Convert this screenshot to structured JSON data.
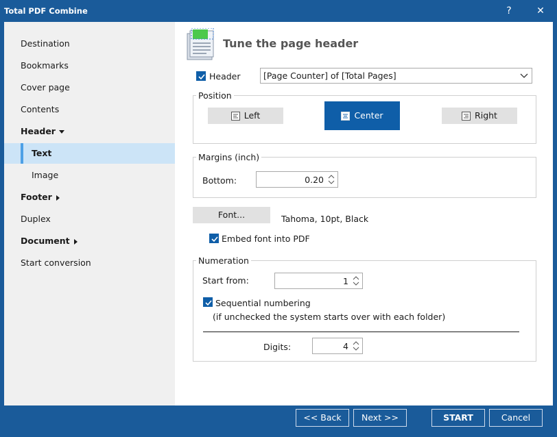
{
  "window": {
    "title": "Total PDF Combine",
    "help_label": "?",
    "close_label": "✕"
  },
  "sidebar": {
    "items": [
      {
        "label": "Destination"
      },
      {
        "label": "Bookmarks"
      },
      {
        "label": "Cover page"
      },
      {
        "label": "Contents"
      },
      {
        "label": "Header"
      },
      {
        "label": "Text"
      },
      {
        "label": "Image"
      },
      {
        "label": "Footer"
      },
      {
        "label": "Duplex"
      },
      {
        "label": "Document"
      },
      {
        "label": "Start conversion"
      }
    ]
  },
  "main": {
    "title": "Tune the page header",
    "header_checkbox": {
      "label": "Header",
      "checked": true
    },
    "header_select": {
      "value": "[Page Counter] of [Total Pages]"
    },
    "position": {
      "title": "Position",
      "buttons": [
        {
          "label": "Left"
        },
        {
          "label": "Center",
          "active": true
        },
        {
          "label": "Right"
        }
      ]
    },
    "margins": {
      "title": "Margins (inch)",
      "bottom_label": "Bottom:",
      "bottom_value": "0.20"
    },
    "font": {
      "button_label": "Font...",
      "description": "Tahoma, 10pt, Black",
      "embed_label": "Embed font into PDF",
      "embed_checked": true
    },
    "numeration": {
      "title": "Numeration",
      "start_label": "Start from:",
      "start_value": "1",
      "sequential_label": "Sequential numbering",
      "sequential_checked": true,
      "sequential_note": "(if unchecked the system starts over with each folder)",
      "digits_label": "Digits:",
      "digits_value": "4"
    }
  },
  "footer": {
    "back_label": "<< Back",
    "next_label": "Next >>",
    "start_label": "START",
    "cancel_label": "Cancel"
  },
  "colors": {
    "accent": "#1a5b9a",
    "active_button": "#0f5ea8",
    "selection": "#cce4f7",
    "selection_bar": "#4da0e6"
  }
}
